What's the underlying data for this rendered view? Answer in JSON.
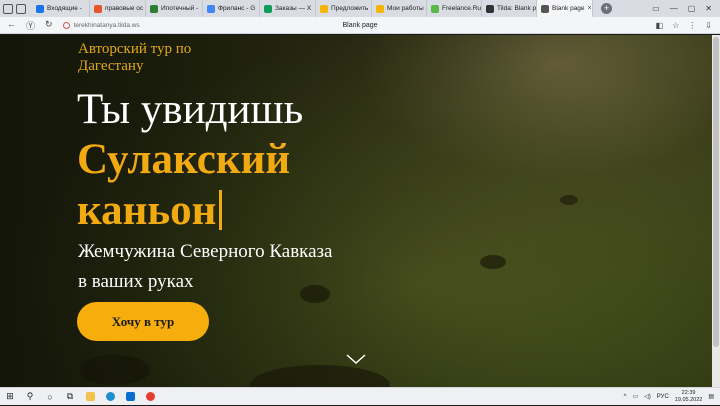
{
  "browser": {
    "tabs": [
      {
        "label": "Входящие -",
        "color": "#1a73e8"
      },
      {
        "label": "правовые ос",
        "color": "#e8562a"
      },
      {
        "label": "Ипотечный -",
        "color": "#2e7d32"
      },
      {
        "label": "Фриланс - G",
        "color": "#4285f4"
      },
      {
        "label": "Заказы — Х",
        "color": "#0f9d58"
      },
      {
        "label": "Предложить",
        "color": "#f5b400"
      },
      {
        "label": "Мои работы",
        "color": "#f5b400"
      },
      {
        "label": "Freelance.Ru",
        "color": "#58b947"
      },
      {
        "label": "Tilda: Blank p",
        "color": "#333333"
      },
      {
        "label": "Blank page",
        "color": "#555555",
        "active": true
      }
    ],
    "url": "terekhinatanya.tilda.ws",
    "page_title": "Blank page"
  },
  "hero": {
    "kicker": "Авторский тур по Дагестану",
    "line1": "Ты увидишь",
    "line2": "Сулакский",
    "line3": "каньон",
    "sub1": "Жемчужина Северного Кавказа",
    "sub2": "в ваших руках",
    "cta_label": "Хочу в тур",
    "accent": "#f2aa12"
  },
  "taskbar": {
    "lang": "РУС",
    "time": "22:39",
    "date": "19.05.2022"
  }
}
